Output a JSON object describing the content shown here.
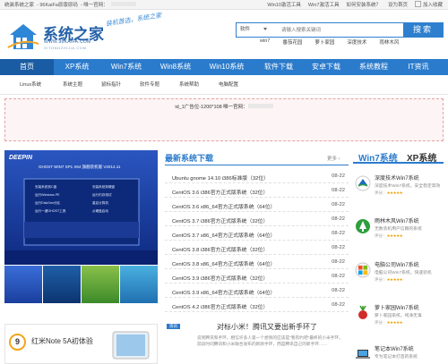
{
  "topbar": {
    "left": [
      "统装系统之家",
      "- 96KaiFa原版原码",
      "- 唯一官网："
    ],
    "right": [
      "Win10激活工具",
      "Win7激活工具",
      "如何安装系统？",
      "设为首页",
      "加入收藏"
    ]
  },
  "header": {
    "title": "系统之家",
    "url": "WWW.96KAIFA.COM",
    "pinyin": "XITONGZHIJIA.COM",
    "slogan": "装机首选，系统之家"
  },
  "search": {
    "select_label": "软件",
    "placeholder": "请输入搜索关键词",
    "button": "搜索",
    "hot_words": [
      "win7",
      "番茄花园",
      "萝卜家园",
      "深度技术",
      "雨林木风"
    ]
  },
  "nav": [
    "首页",
    "XP系统",
    "Win7系统",
    "Win8系统",
    "Win10系统",
    "软件下载",
    "安卓下载",
    "系统教程",
    "IT资讯"
  ],
  "subnav": [
    "Linux系统",
    "系统主题",
    "鼠标指针",
    "软件专题",
    "系统帮助",
    "电脑配置"
  ],
  "ad": {
    "text": "id_1广告位-1200*108  唯一官网："
  },
  "banner": {
    "brand": "DEEPIN",
    "title": "GHOST WIN7 SP1 X64 旗舰装机版 V2014.11",
    "menu": [
      "安装系统到C盘",
      "运行Windows PE",
      "运行DiskGen分区",
      "运行一键GHOST工具",
      "安装系统到硬盘",
      "运行内存测试",
      "重启计算机",
      "从硬盘启动"
    ],
    "colors": {
      "bg": "#1a3f9e",
      "panel": "#0d2a7a"
    }
  },
  "downloads": {
    "title": "最新系统下载",
    "more": "更多",
    "items": [
      {
        "name": "Ubuntu gnome 14.10 i386标准版（32位）",
        "date": "08-22"
      },
      {
        "name": "CentOS 3.6 i386官方正式版系统（32位）",
        "date": "08-22"
      },
      {
        "name": "CentOS 3.6 x86_64官方正式版系统（64位）",
        "date": "08-22"
      },
      {
        "name": "CentOS 3.7 i386官方正式版系统（32位）",
        "date": "08-22"
      },
      {
        "name": "CentOS 3.7 x86_64官方正式版系统（64位）",
        "date": "08-22"
      },
      {
        "name": "CentOS 3.8 i386官方正式版系统（32位）",
        "date": "08-22"
      },
      {
        "name": "CentOS 3.8 x86_64官方正式版系统（64位）",
        "date": "08-22"
      },
      {
        "name": "CentOS 3.9 i386官方正式版系统（32位）",
        "date": "08-22"
      },
      {
        "name": "CentOS 3.9 x86_64官方正式版系统（64位）",
        "date": "08-22"
      },
      {
        "name": "CentOS 4.2 i386官方正式版系统（32位）",
        "date": "08-22"
      }
    ]
  },
  "sidebar": {
    "tabs": [
      "Win7系统",
      "XP系统"
    ],
    "items": [
      {
        "name": "深度技术Win7系统",
        "desc": "深度技术Win7系统，安全稳定高效",
        "rating": "评分：",
        "stars": "★★★★★",
        "icon": "deepin-icon"
      },
      {
        "name": "雨林木风Win7系统",
        "desc": "无数装机用户信赖的系统",
        "rating": "评分：",
        "stars": "★★★★★",
        "icon": "ylmf-icon"
      },
      {
        "name": "电脑公司Win7系统",
        "desc": "电脑公司Win7系统，快速装机",
        "rating": "评分：",
        "stars": "★★★★★",
        "icon": "windows-icon"
      },
      {
        "name": "萝卜家园Win7系统",
        "desc": "萝卜家园系统，纯净无毒",
        "rating": "评分：",
        "stars": "★★★★★",
        "icon": "radish-icon"
      },
      {
        "name": "笔记本Win7系统",
        "desc": "专为笔记本打造的系统",
        "rating": "",
        "stars": "",
        "icon": "laptop-icon"
      }
    ]
  },
  "note": {
    "badge": "9",
    "title": "红米Note 5A初体验"
  },
  "news": {
    "tag": "资讯",
    "title": "对标小米！腾讯又要出新手环了",
    "desc": "说到腾讯和手环，相信许多人第一个想到的应该是\"我有约吧\"最终的小米手环，前段时间腾讯和小米联合发布的新款手环，而是腾讯自己的新手环……"
  }
}
